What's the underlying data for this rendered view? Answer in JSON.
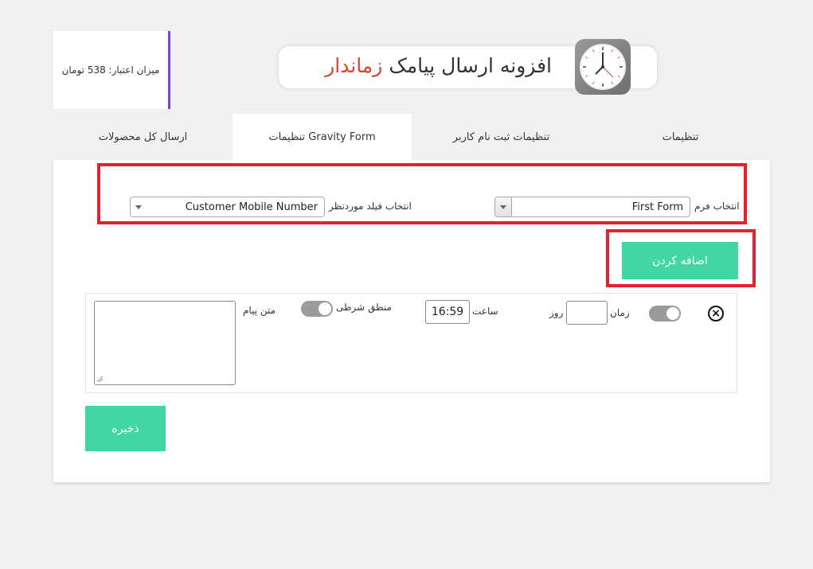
{
  "credit": {
    "text": "میزان اعتبار: 538 تومان"
  },
  "header": {
    "title_main": "افزونه ارسال پیامک ",
    "title_accent": "زماندار"
  },
  "tabs": [
    {
      "label": "تنظیمات"
    },
    {
      "label": "تنظیمات ثبت نام کاربر"
    },
    {
      "label": "تنظیمات Gravity Form"
    },
    {
      "label": "ارسال کل محصولات"
    }
  ],
  "form_select": {
    "label": "انتخاب فرم",
    "value": "First Form"
  },
  "field_select": {
    "label": "انتخاب فیلد موردنظر",
    "value": "Customer Mobile Number"
  },
  "add_button": {
    "label": "اضافه کردن"
  },
  "rule": {
    "time_label": "زمان",
    "day_label": "روز",
    "day_value": "",
    "hour_label": "ساعت",
    "hour_value": "16:59",
    "condition_label": "منطق شرطی",
    "message_label": "متن پیام",
    "message_value": "",
    "remove_symbol": "×"
  },
  "save_button": {
    "label": "ذخیره"
  },
  "colors": {
    "accent_green": "#42d6a4",
    "highlight_red": "#e0232e",
    "sidebar_purple": "#7b3fe4",
    "title_red": "#d9432f"
  }
}
